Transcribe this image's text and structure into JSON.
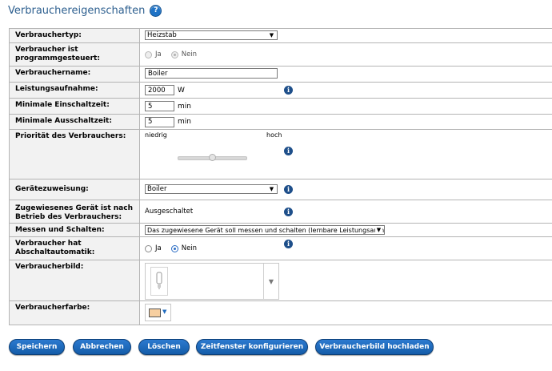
{
  "title": "Verbrauchereigenschaften",
  "help_glyph": "?",
  "info_glyph": "i",
  "fields": {
    "typ": {
      "label": "Verbrauchertyp:",
      "value": "Heizstab"
    },
    "programm": {
      "label": "Verbraucher ist programmgesteuert:",
      "opt_ja": "Ja",
      "opt_nein": "Nein",
      "selected": "Nein",
      "disabled": true
    },
    "name": {
      "label": "Verbrauchername:",
      "value": "Boiler"
    },
    "leistung": {
      "label": "Leistungsaufnahme:",
      "value": "2000",
      "unit": "W"
    },
    "min_ein": {
      "label": "Minimale Einschaltzeit:",
      "value": "5",
      "unit": "min"
    },
    "min_aus": {
      "label": "Minimale Ausschaltzeit:",
      "value": "5",
      "unit": "min"
    },
    "prio": {
      "label": "Priorität des Verbrauchers:",
      "low": "niedrig",
      "high": "hoch",
      "level": 0.5
    },
    "geraet": {
      "label": "Gerätezuweisung:",
      "value": "Boiler"
    },
    "zugewiesen": {
      "label": "Zugewiesenes Gerät ist nach Betrieb des Verbrauchers:",
      "value": "Ausgeschaltet"
    },
    "messen": {
      "label": "Messen und Schalten:",
      "value": "Das zugewiesene Gerät soll messen und schalten (lernbare Leistungsaufnahr"
    },
    "abschalt": {
      "label": "Verbraucher hat Abschaltautomatik:",
      "opt_ja": "Ja",
      "opt_nein": "Nein",
      "selected": "Nein"
    },
    "bild": {
      "label": "Verbraucherbild:",
      "icon": "light-bulb-icon"
    },
    "farbe": {
      "label": "Verbraucherfarbe:",
      "color": "#f7cfa0"
    }
  },
  "buttons": {
    "speichern": "Speichern",
    "abbrechen": "Abbrechen",
    "loeschen": "Löschen",
    "zeitfenster": "Zeitfenster konfigurieren",
    "hochladen": "Verbraucherbild hochladen"
  },
  "colors": {
    "accent": "#1f6bbf",
    "title": "#2d5f8f",
    "label_bg": "#f2f2f2"
  }
}
